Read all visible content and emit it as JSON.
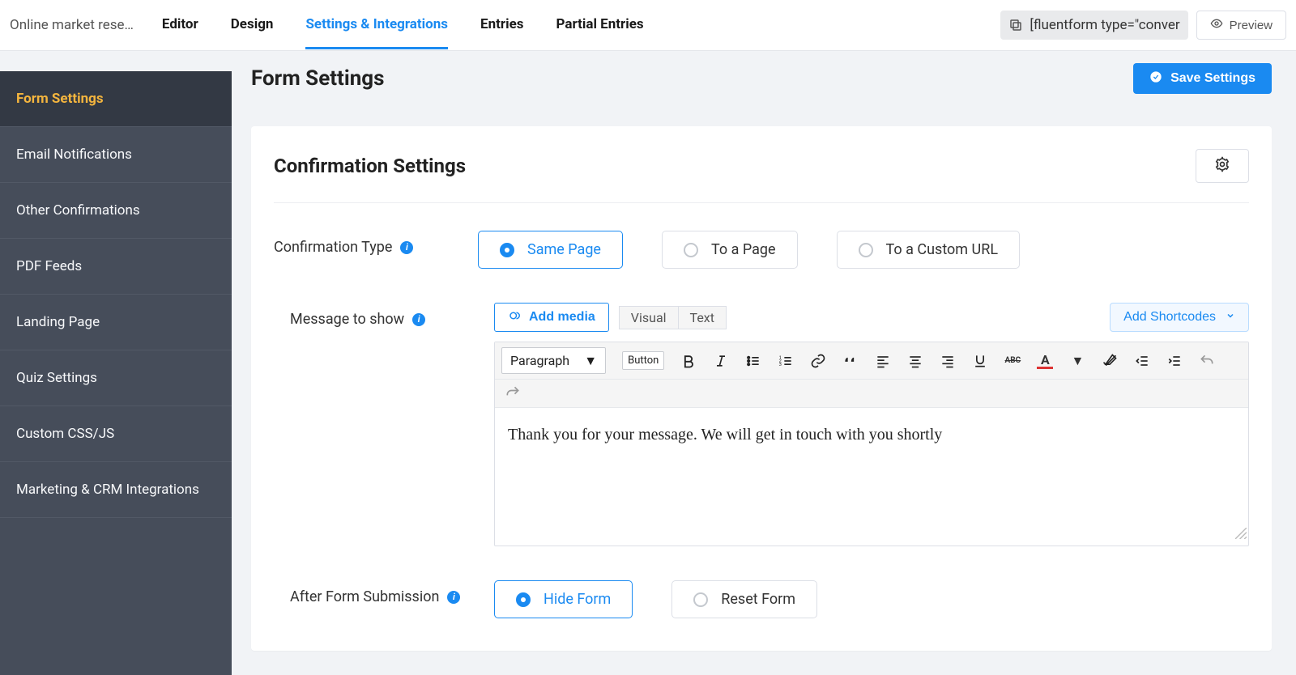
{
  "form_name": "Online market rese…",
  "top_tabs": [
    "Editor",
    "Design",
    "Settings & Integrations",
    "Entries",
    "Partial Entries"
  ],
  "active_top_tab": 2,
  "shortcode": "[fluentform type=\"conver",
  "preview_label": "Preview",
  "sidebar": {
    "items": [
      "Form Settings",
      "Email Notifications",
      "Other Confirmations",
      "PDF Feeds",
      "Landing Page",
      "Quiz Settings",
      "Custom CSS/JS",
      "Marketing & CRM Integrations"
    ],
    "active": 0
  },
  "page_title": "Form Settings",
  "save_button": "Save Settings",
  "section_title": "Confirmation Settings",
  "confirmation_type": {
    "label": "Confirmation Type",
    "options": [
      "Same Page",
      "To a Page",
      "To a Custom URL"
    ],
    "selected": 0
  },
  "message": {
    "label": "Message to show",
    "add_media": "Add media",
    "editor_tabs": [
      "Visual",
      "Text"
    ],
    "paragraph_select": "Paragraph",
    "button_chip": "Button",
    "add_shortcodes": "Add Shortcodes",
    "body": "Thank you for your message. We will get in touch with you shortly"
  },
  "after_submit": {
    "label": "After Form Submission",
    "options": [
      "Hide Form",
      "Reset Form"
    ],
    "selected": 0
  }
}
